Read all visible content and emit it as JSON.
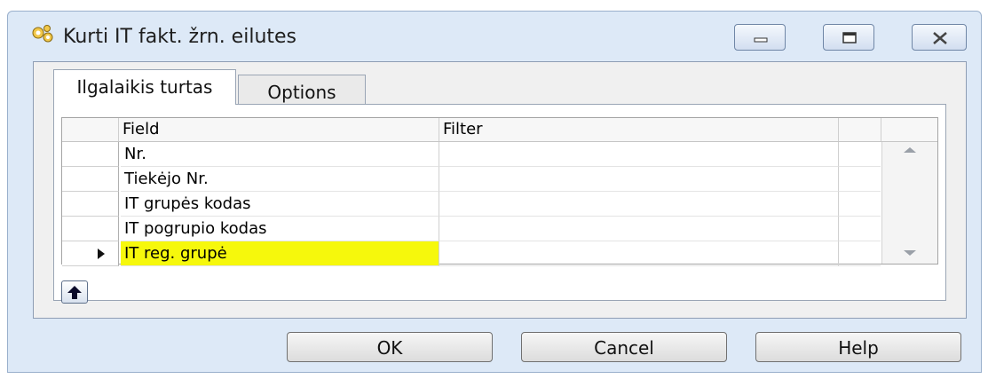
{
  "window": {
    "title": "Kurti IT fakt. žrn. eilutes",
    "app_icon": "gear-cluster-icon",
    "minimize_icon": "minimize-icon",
    "maximize_icon": "maximize-icon",
    "close_icon": "close-icon"
  },
  "tabs": [
    {
      "label": "Ilgalaikis turtas",
      "active": true
    },
    {
      "label": "Options",
      "active": false
    }
  ],
  "grid": {
    "columns": [
      "Field",
      "Filter"
    ],
    "rows": [
      {
        "field": "Nr.",
        "filter": "",
        "current": false
      },
      {
        "field": "Tiekėjo Nr.",
        "filter": "",
        "current": false
      },
      {
        "field": "IT grupės kodas",
        "filter": "",
        "current": false
      },
      {
        "field": "IT pogrupio kodas",
        "filter": "",
        "current": false
      },
      {
        "field": "IT reg. grupė",
        "filter": "",
        "current": true
      }
    ],
    "current_row_icon": "row-pointer-icon",
    "scroll_up_icon": "scroll-up-icon",
    "scroll_down_icon": "scroll-down-icon",
    "highlight_color": "#f6f80c"
  },
  "move_up_icon": "arrow-up-icon",
  "buttons": {
    "ok": "OK",
    "cancel": "Cancel",
    "help": "Help"
  }
}
